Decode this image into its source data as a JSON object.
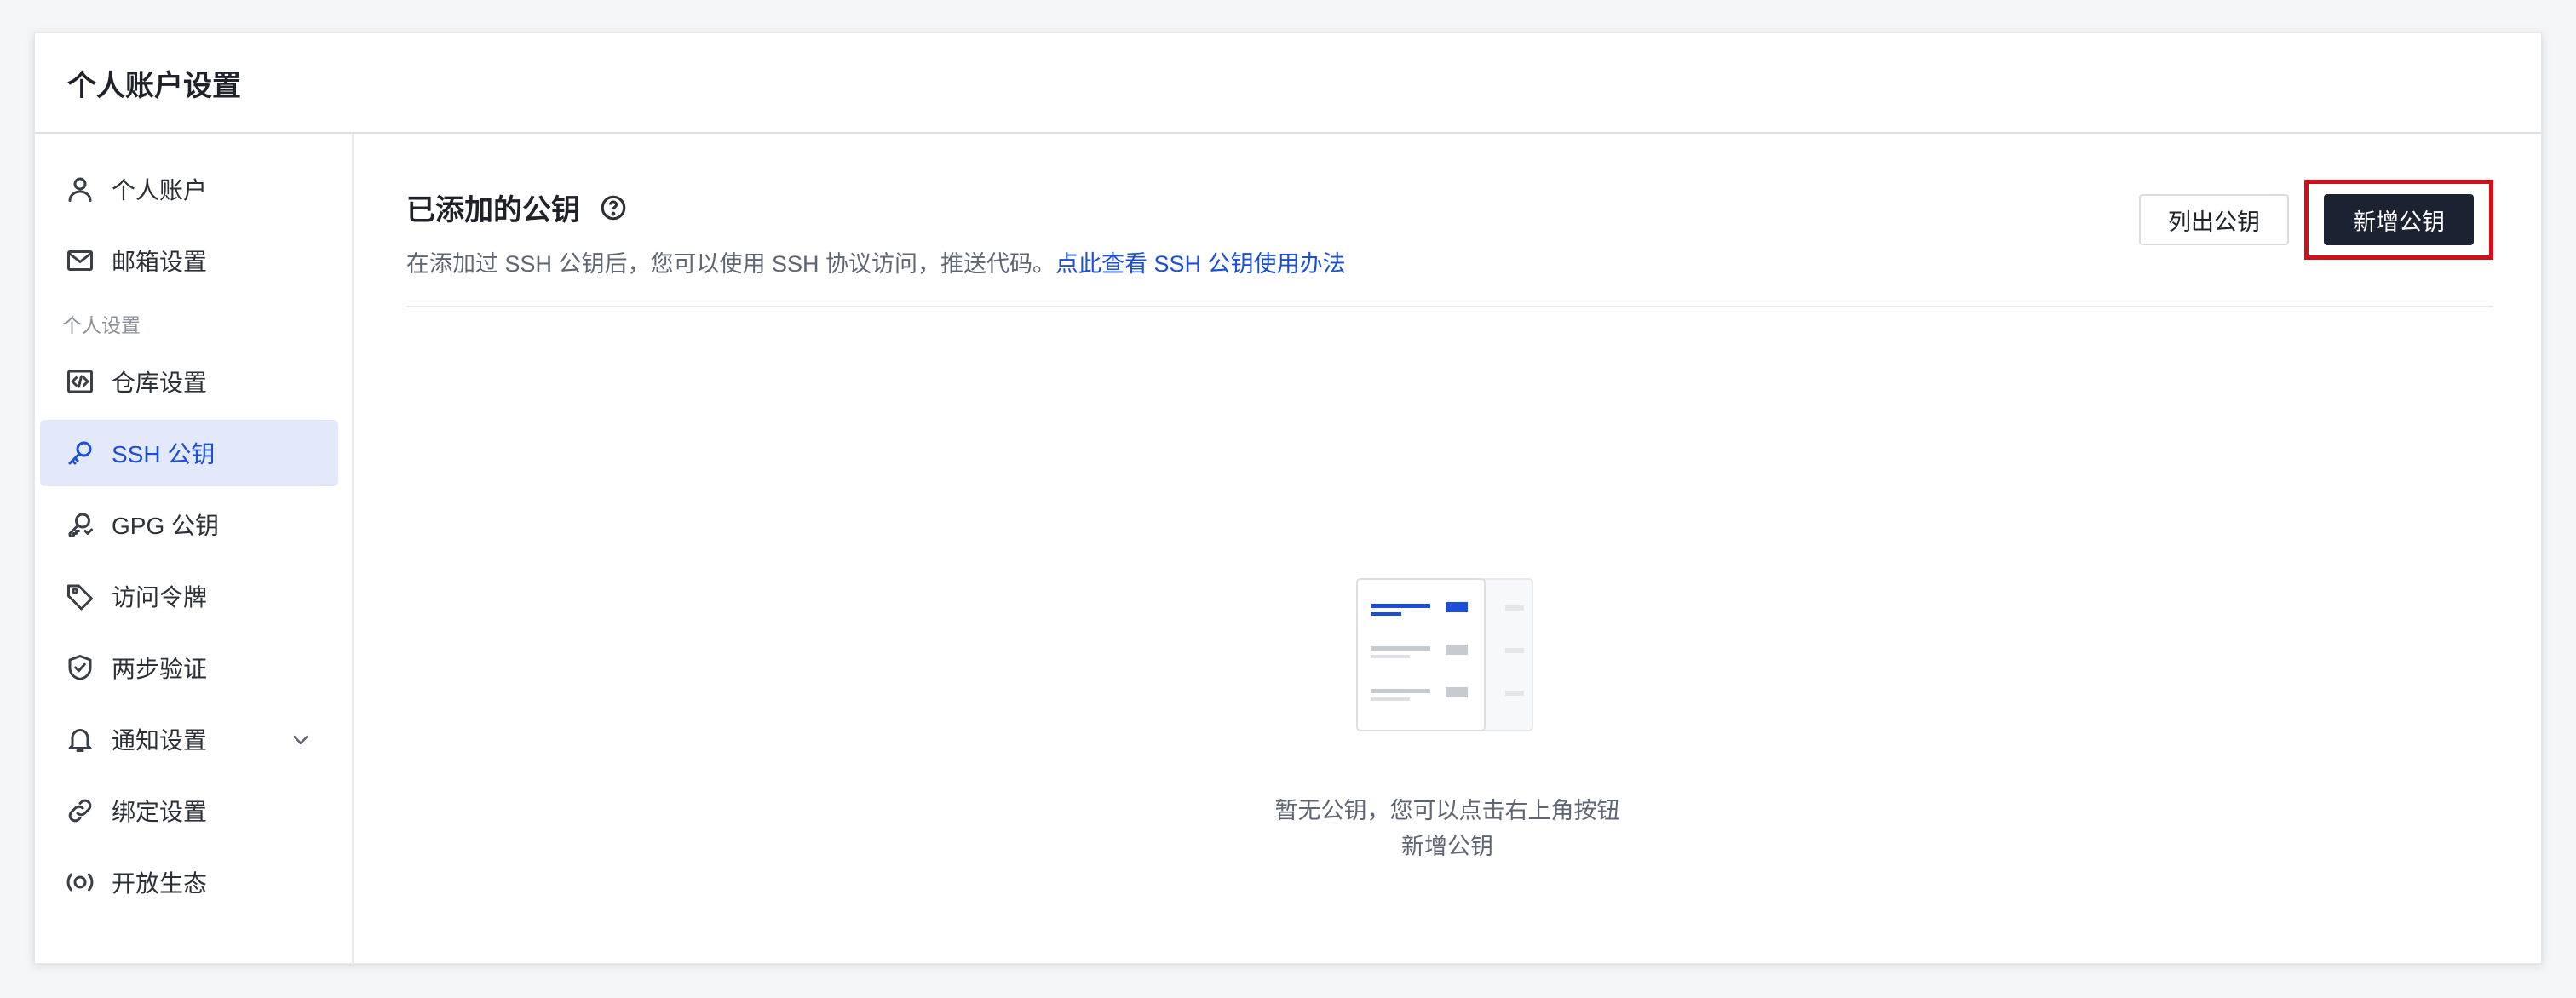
{
  "window": {
    "title": "个人账户设置"
  },
  "sidebar": {
    "items_top": [
      {
        "label": "个人账户",
        "icon": "user-icon"
      },
      {
        "label": "邮箱设置",
        "icon": "mail-icon"
      }
    ],
    "section_label": "个人设置",
    "items": [
      {
        "label": "仓库设置",
        "icon": "code-icon"
      },
      {
        "label": "SSH 公钥",
        "icon": "key-icon",
        "active": true
      },
      {
        "label": "GPG 公钥",
        "icon": "gpg-key-icon"
      },
      {
        "label": "访问令牌",
        "icon": "tag-icon"
      },
      {
        "label": "两步验证",
        "icon": "shield-check-icon"
      },
      {
        "label": "通知设置",
        "icon": "bell-icon",
        "expandable": true
      },
      {
        "label": "绑定设置",
        "icon": "link-icon"
      },
      {
        "label": "开放生态",
        "icon": "ecosystem-icon"
      }
    ]
  },
  "main": {
    "heading": "已添加的公钥",
    "description": "在添加过 SSH 公钥后，您可以使用 SSH 协议访问，推送代码。",
    "description_link": "点此查看 SSH 公钥使用办法",
    "list_button": "列出公钥",
    "add_button": "新增公钥",
    "empty_line1": "暂无公钥，您可以点击右上角按钮",
    "empty_line2": "新增公钥"
  },
  "colors": {
    "accent": "#1a4fd6",
    "active_bg": "#e3e9fb",
    "primary_button": "#1b2232",
    "highlight_box": "#d0101b"
  }
}
